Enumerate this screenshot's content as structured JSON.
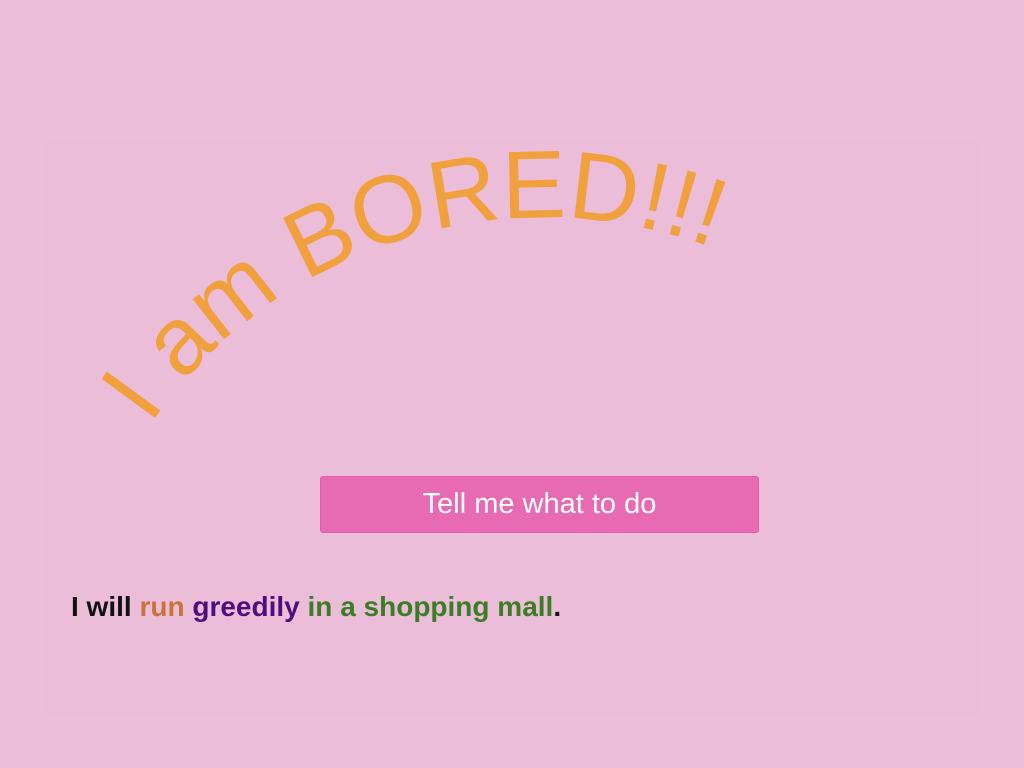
{
  "title": {
    "text": "I am BORED!!!",
    "color": "#f0a03c"
  },
  "button": {
    "label": "Tell me what to do",
    "color": "#e86ab2"
  },
  "sentence": {
    "parts": [
      {
        "text": "I will ",
        "color": "#111111"
      },
      {
        "text": "run",
        "color": "#c8733a"
      },
      {
        "text": " ",
        "color": "#111111"
      },
      {
        "text": "greedily",
        "color": "#4f0e7e"
      },
      {
        "text": " ",
        "color": "#111111"
      },
      {
        "text": "in a shopping mall",
        "color": "#3b7d24"
      },
      {
        "text": ".",
        "color": "#111111"
      }
    ]
  },
  "background_color": "#ecbfd9"
}
